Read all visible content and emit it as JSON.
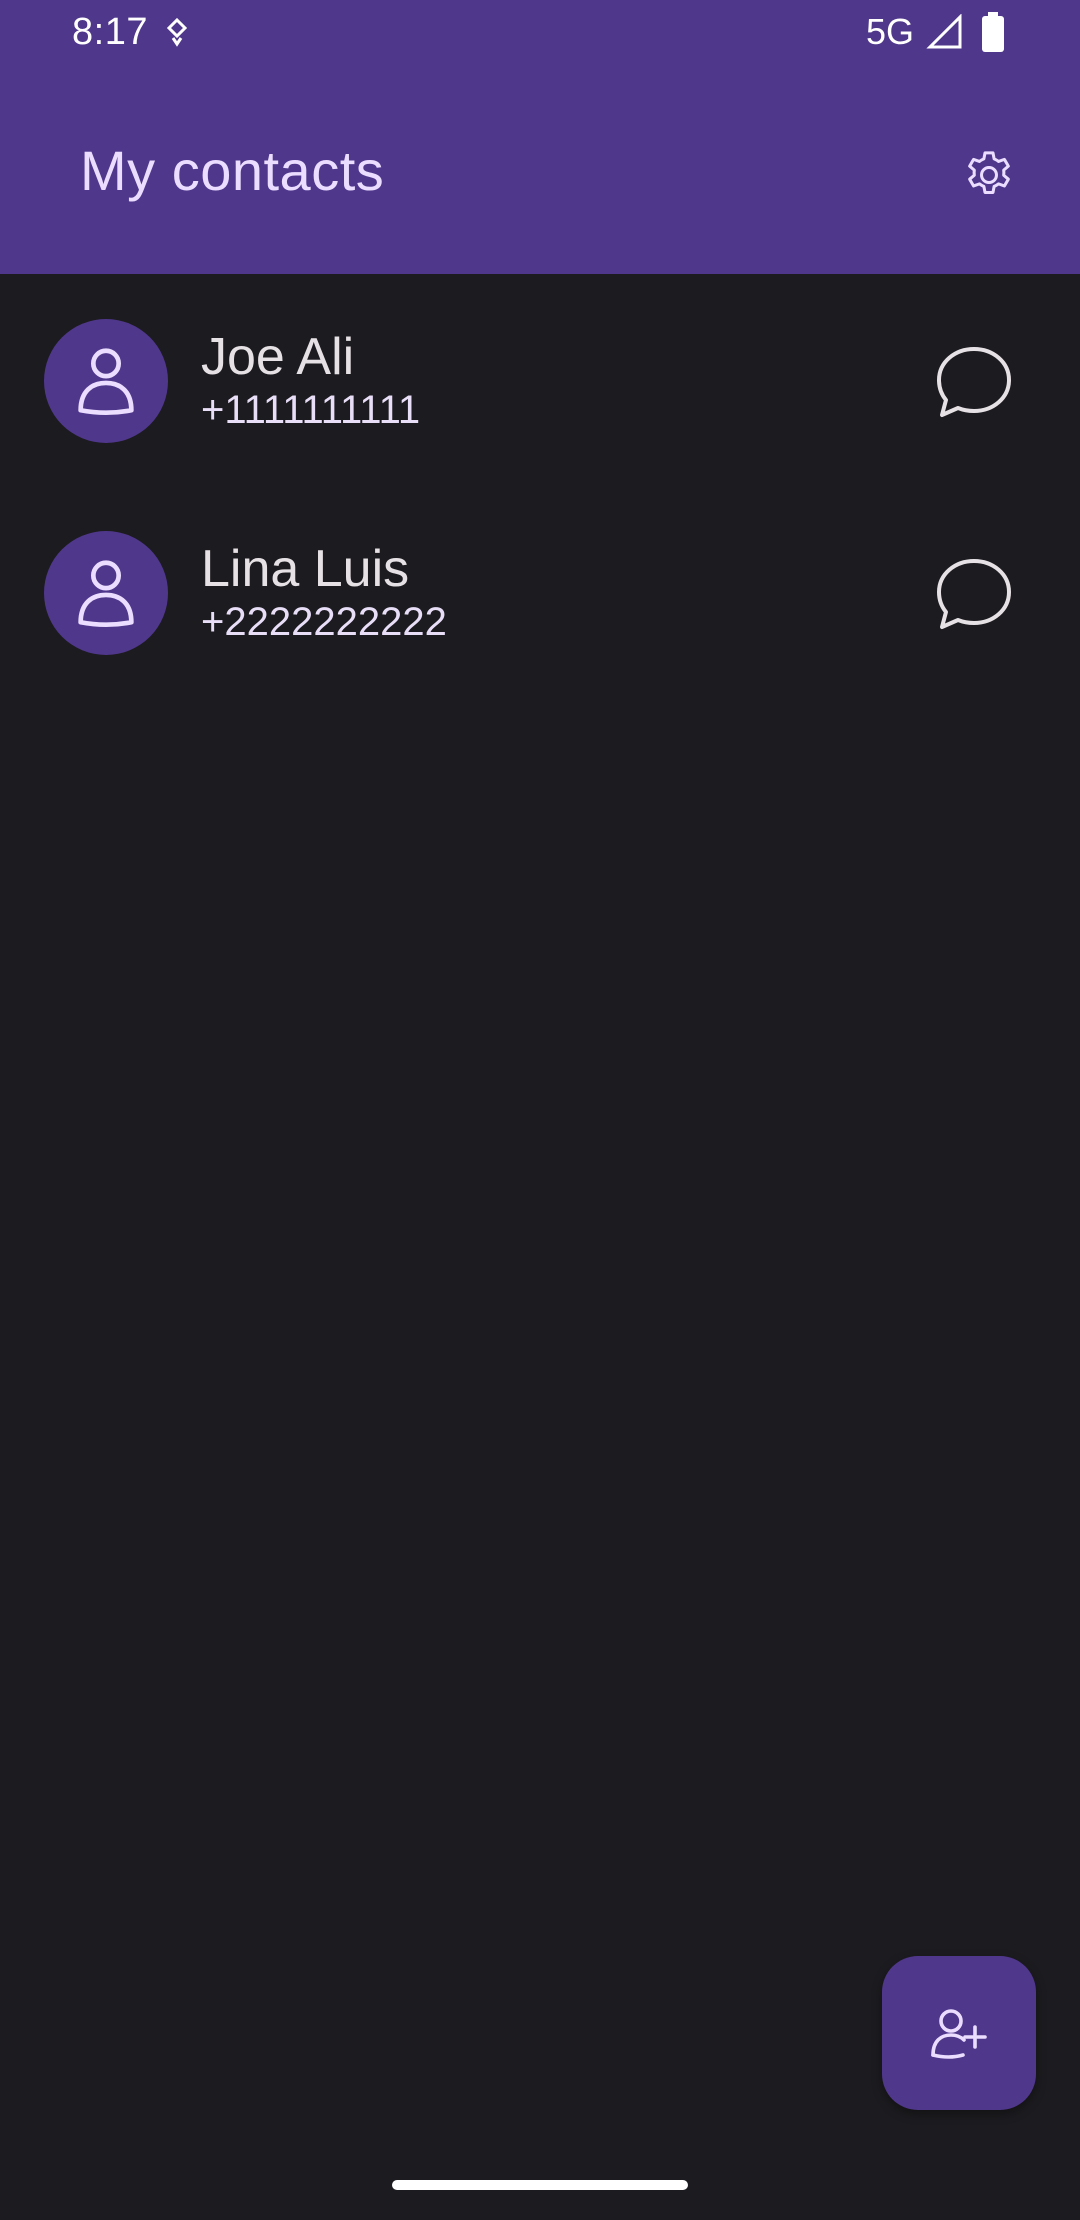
{
  "status_bar": {
    "time": "8:17",
    "network": "5G",
    "icons": [
      "notification-icon",
      "signal-icon",
      "battery-icon"
    ]
  },
  "app_bar": {
    "title": "My contacts",
    "settings_icon": "gear-icon"
  },
  "contacts": [
    {
      "name": "Joe Ali",
      "phone": "+1111111111",
      "avatar_icon": "person-icon",
      "action_icon": "chat-bubble-icon"
    },
    {
      "name": "Lina Luis",
      "phone": "+2222222222",
      "avatar_icon": "person-icon",
      "action_icon": "chat-bubble-icon"
    }
  ],
  "fab": {
    "icon": "add-person-icon"
  },
  "colors": {
    "primary": "#4f378b",
    "background": "#1c1b1f",
    "title_text": "#eaddff",
    "name_text": "#e6e1e5",
    "phone_text": "#e8def8"
  }
}
